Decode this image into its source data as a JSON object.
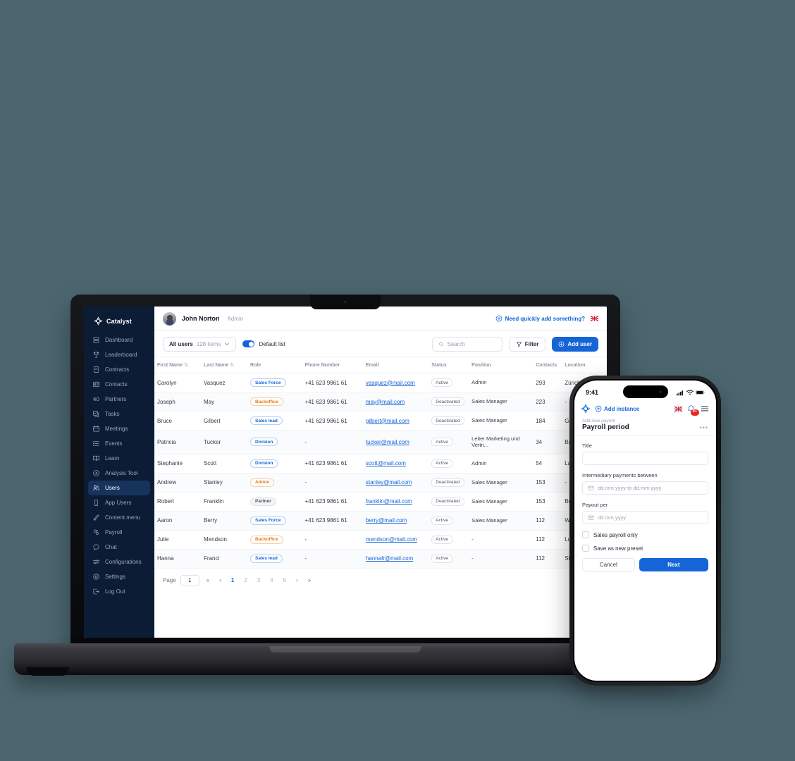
{
  "background_color": "#4c6670",
  "accent_color": "#1565d8",
  "sidebar_color": "#0c1c35",
  "desktop": {
    "brand": {
      "name": "Catalyst",
      "icon": "catalyst-logo-icon"
    },
    "sidebar": {
      "items": [
        {
          "label": "Dashboard",
          "icon": "dashboard-icon",
          "active": false
        },
        {
          "label": "Leaderboard",
          "icon": "trophy-icon",
          "active": false
        },
        {
          "label": "Contracts",
          "icon": "contract-icon",
          "active": false
        },
        {
          "label": "Contacts",
          "icon": "contacts-icon",
          "active": false
        },
        {
          "label": "Partners",
          "icon": "partners-icon",
          "active": false
        },
        {
          "label": "Tasks",
          "icon": "tasks-icon",
          "active": false
        },
        {
          "label": "Meetings",
          "icon": "calendar-icon",
          "active": false
        },
        {
          "label": "Events",
          "icon": "list-icon",
          "active": false
        },
        {
          "label": "Learn",
          "icon": "book-icon",
          "active": false
        },
        {
          "label": "Analysis Tool",
          "icon": "analysis-icon",
          "active": false
        },
        {
          "label": "Users",
          "icon": "users-icon",
          "active": true
        },
        {
          "label": "App Users",
          "icon": "mobile-icon",
          "active": false
        },
        {
          "label": "Content menu",
          "icon": "pencil-icon",
          "active": false
        },
        {
          "label": "Payroll",
          "icon": "payroll-icon",
          "active": false
        },
        {
          "label": "Chat",
          "icon": "chat-icon",
          "active": false
        },
        {
          "label": "Configurations",
          "icon": "sliders-icon",
          "active": false
        },
        {
          "label": "Settings",
          "icon": "gear-icon",
          "active": false
        },
        {
          "label": "Log Out",
          "icon": "logout-icon",
          "active": false
        }
      ]
    },
    "topbar": {
      "user_name": "John Norton",
      "user_role": "Admin",
      "quick_add_label": "Need quickly add something?",
      "quick_add_icon": "plus-circle-icon",
      "flag_icon": "uk-flag-icon",
      "avatar_icon": "avatar"
    },
    "toolbar": {
      "list_select_label": "All users",
      "list_select_count": "128 items",
      "chevron_icon": "chevron-down-icon",
      "toggle_on": true,
      "toggle_label": "Default list",
      "search_placeholder": "Search",
      "search_value": "",
      "search_icon": "search-icon",
      "filter_label": "Filter",
      "filter_icon": "funnel-icon",
      "add_user_label": "Add user",
      "add_user_icon": "plus-circle-icon"
    },
    "table": {
      "columns": [
        {
          "label": "First Name",
          "sortable": true
        },
        {
          "label": "Last Name",
          "sortable": true
        },
        {
          "label": "Role",
          "sortable": false
        },
        {
          "label": "Phone Number",
          "sortable": false
        },
        {
          "label": "Email",
          "sortable": false
        },
        {
          "label": "Status",
          "sortable": false
        },
        {
          "label": "Position",
          "sortable": false
        },
        {
          "label": "Contacts",
          "sortable": false
        },
        {
          "label": "Location",
          "sortable": false
        }
      ],
      "rows": [
        {
          "first": "Carolyn",
          "last": "Vasquez",
          "role": "Sales Force",
          "role_tone": "blue",
          "phone": "+41 623 9861 61",
          "email": "vasquez@mail.com",
          "status": "Active",
          "position": "Admin",
          "contacts": "293",
          "location": "Zürich"
        },
        {
          "first": "Joseph",
          "last": "May",
          "role": "Backoffice",
          "role_tone": "orange",
          "phone": "+41 623 9861 61",
          "email": "may@mail.com",
          "status": "Deactivated",
          "position": "Sales Manager",
          "contacts": "223",
          "location": "-"
        },
        {
          "first": "Bruce",
          "last": "Gilbert",
          "role": "Sales lead",
          "role_tone": "blue",
          "phone": "+41 623 9861 61",
          "email": "gilbert@mail.com",
          "status": "Deactivated",
          "position": "Sales Manager",
          "contacts": "184",
          "location": "Geneva"
        },
        {
          "first": "Patricia",
          "last": "Tucker",
          "role": "Division",
          "role_tone": "blue",
          "phone": "-",
          "email": "tucker@mail.com",
          "status": "Active",
          "position": "Leiter Marketing und Vertri...",
          "contacts": "34",
          "location": "Basel"
        },
        {
          "first": "Stephanie",
          "last": "Scott",
          "role": "Division",
          "role_tone": "blue",
          "phone": "+41 623 9861 61",
          "email": "scott@mail.com",
          "status": "Active",
          "position": "Admin",
          "contacts": "54",
          "location": "Lausanne"
        },
        {
          "first": "Andrew",
          "last": "Stanley",
          "role": "Admin",
          "role_tone": "orange",
          "phone": "-",
          "email": "stanley@mail.com",
          "status": "Deactivated",
          "position": "Sales Manager",
          "contacts": "153",
          "location": "-"
        },
        {
          "first": "Robert",
          "last": "Franklin",
          "role": "Partner",
          "role_tone": "gray",
          "phone": "+41 623 9861 61",
          "email": "franklin@mail.com",
          "status": "Deactivated",
          "position": "Sales Manager",
          "contacts": "153",
          "location": "Bern"
        },
        {
          "first": "Aaron",
          "last": "Berry",
          "role": "Sales Force",
          "role_tone": "blue",
          "phone": "+41 623 9861 61",
          "email": "berry@mail.com",
          "status": "Active",
          "position": "Sales Manager",
          "contacts": "112",
          "location": "Winterthur"
        },
        {
          "first": "Julie",
          "last": "Mendson",
          "role": "Backoffice",
          "role_tone": "orange",
          "phone": "-",
          "email": "mendson@mail.com",
          "status": "Active",
          "position": "-",
          "contacts": "112",
          "location": "Lucerne"
        },
        {
          "first": "Hanna",
          "last": "Franci",
          "role": "Sales lead",
          "role_tone": "blue",
          "phone": "-",
          "email": "hannafr@mail.com",
          "status": "Active",
          "position": "-",
          "contacts": "112",
          "location": "St Gallen"
        }
      ]
    },
    "pagination": {
      "label": "Page",
      "current_value": "1",
      "first_icon": "first-page-icon",
      "prev_icon": "prev-page-icon",
      "pages": [
        "1",
        "2",
        "3",
        "4",
        "5"
      ],
      "active_page": "1",
      "next_icon": "next-page-icon",
      "last_icon": "last-page-icon"
    }
  },
  "mobile": {
    "status_bar": {
      "time": "9:41",
      "signal_icon": "cellular-icon",
      "wifi_icon": "wifi-icon",
      "battery_icon": "battery-icon"
    },
    "header": {
      "logo_icon": "catalyst-logo-icon",
      "add_instance_label": "Add instance",
      "add_instance_icon": "plus-circle-icon",
      "flag_icon": "uk-flag-icon",
      "bell_icon": "bell-icon",
      "bell_badge": "9+",
      "menu_icon": "hamburger-menu-icon"
    },
    "breadcrumb": "Add new payroll",
    "title": "Payroll period",
    "more_icon": "more-dots-icon",
    "fields": [
      {
        "label": "Title",
        "placeholder": "",
        "value": "",
        "icon": null
      },
      {
        "label": "Intermediary payments between",
        "placeholder": "dd.mm.yyyy to dd.mm.yyyy",
        "value": "",
        "icon": "calendar-icon"
      },
      {
        "label": "Payout per",
        "placeholder": "dd.mm.yyyy",
        "value": "",
        "icon": "calendar-icon"
      }
    ],
    "checkboxes": [
      {
        "label": "Sales payroll only",
        "checked": false
      },
      {
        "label": "Save as new preset",
        "checked": false
      }
    ],
    "actions": {
      "cancel_label": "Cancel",
      "next_label": "Next"
    }
  }
}
